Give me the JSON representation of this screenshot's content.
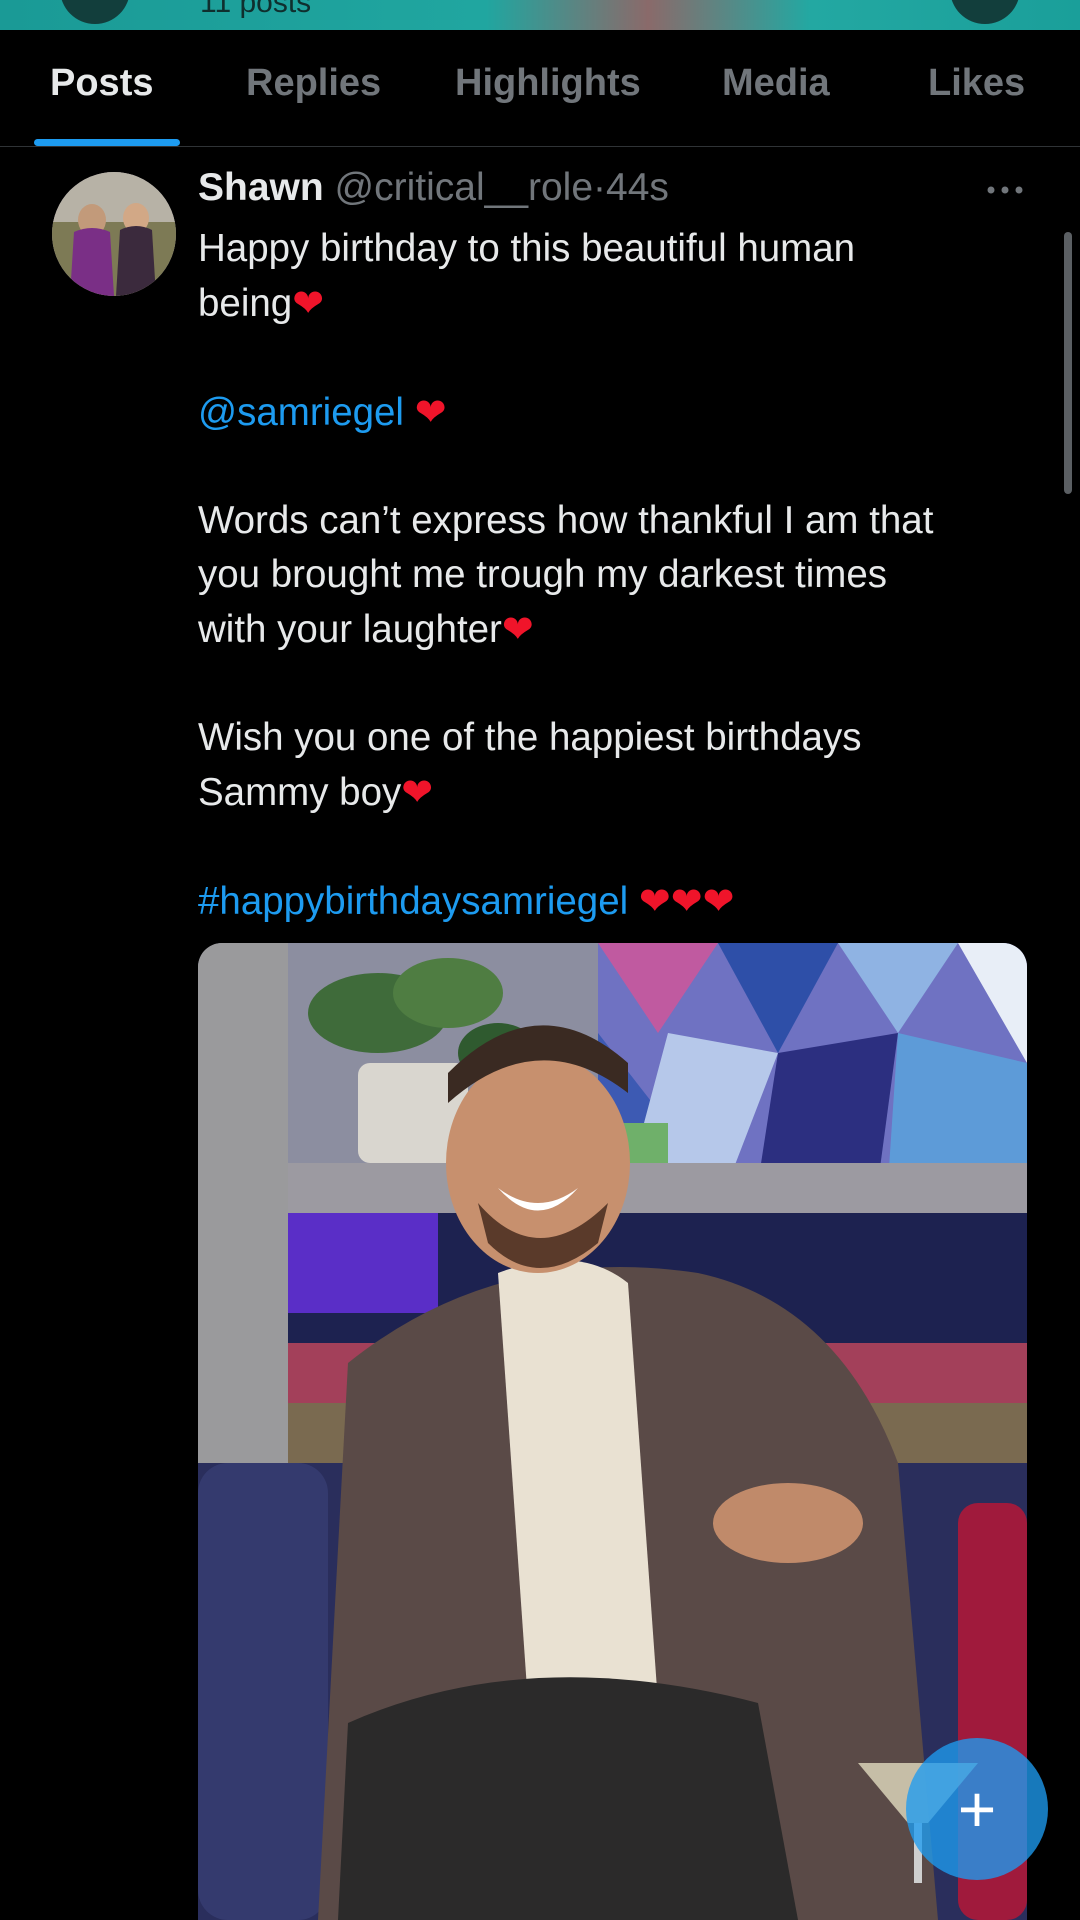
{
  "header": {
    "post_count": "11 posts"
  },
  "tabs": [
    {
      "label": "Posts",
      "active": true
    },
    {
      "label": "Replies",
      "active": false
    },
    {
      "label": "Highlights",
      "active": false
    },
    {
      "label": "Media",
      "active": false
    },
    {
      "label": "Likes",
      "active": false
    }
  ],
  "post": {
    "display_name": "Shawn",
    "handle": "@critical__role",
    "separator": "·",
    "time": "44s",
    "lines": {
      "l1": "Happy birthday to this beautiful human",
      "l2": "being",
      "mention": "@samriegel",
      "l3": "Words can’t express how thankful I am that",
      "l4": "you brought me trough my darkest times",
      "l5": "with your laughter",
      "l6": "Wish you one of the happiest birthdays",
      "l7": "Sammy boy",
      "hashtag": "#happybirthdaysamriegel"
    },
    "heart": "❤"
  },
  "icons": {
    "more": "more-horizontal-icon",
    "fab": "plus-icon"
  },
  "colors": {
    "accent": "#1d9bf0",
    "heart": "#f0142a",
    "background": "#000000"
  }
}
